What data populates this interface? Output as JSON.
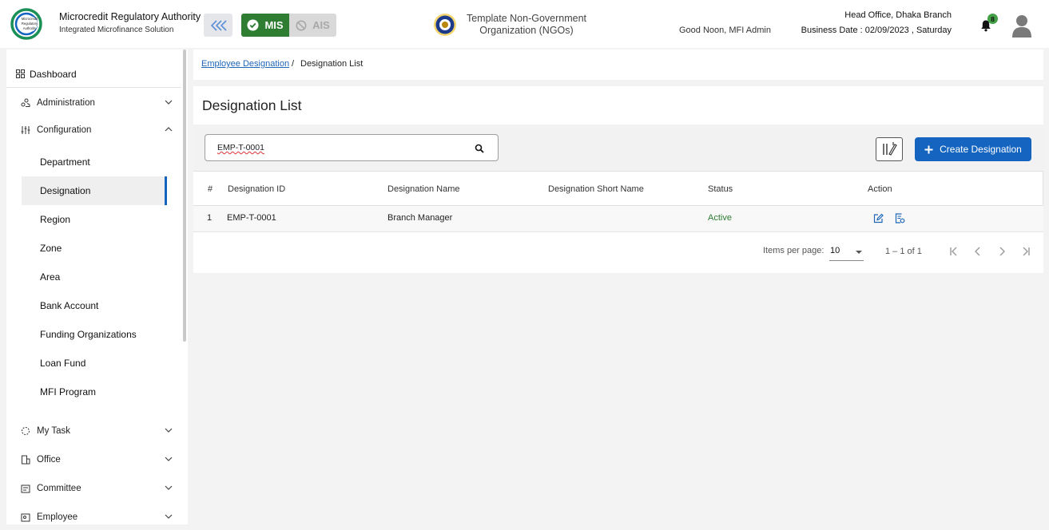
{
  "header": {
    "brand_title": "Microcredit Regulatory Authority",
    "brand_subtitle": "Integrated Microfinance Solution",
    "logo_text": [
      "Microcredit",
      "Regulatory",
      "Authority"
    ],
    "mis_label": "MIS",
    "ais_label": "AIS",
    "org_name_line1": "Template Non-Government",
    "org_name_line2": "Organization (NGOs)",
    "greeting": "Good Noon, MFI Admin",
    "branch": "Head Office, Dhaka Branch",
    "business_date": "Business Date : 02/09/2023 , Saturday",
    "notification_count": "8"
  },
  "sidebar": {
    "dashboard": "Dashboard",
    "administration": "Administration",
    "configuration": "Configuration",
    "config_items": [
      "Department",
      "Designation",
      "Region",
      "Zone",
      "Area",
      "Bank Account",
      "Funding Organizations",
      "Loan Fund",
      "MFI Program"
    ],
    "active_item": "Designation",
    "my_task": "My Task",
    "office": "Office",
    "committee": "Committee",
    "employee": "Employee"
  },
  "breadcrumb": {
    "parent": "Employee Designation",
    "separator": "/",
    "current": "Designation List"
  },
  "main": {
    "title": "Designation List",
    "search_value": "EMP-T-0001",
    "create_label": "Create Designation"
  },
  "table": {
    "headers": [
      "#",
      "Designation ID",
      "Designation Name",
      "Designation Short Name",
      "Status",
      "Action"
    ],
    "rows": [
      {
        "no": "1",
        "id": "EMP-T-0001",
        "name": "Branch Manager",
        "short_name": "",
        "status": "Active"
      }
    ]
  },
  "pagination": {
    "items_label": "Items per page:",
    "page_size": "10",
    "range": "1 – 1 of 1"
  },
  "colors": {
    "primary": "#1565c0",
    "mis_green": "#2e7d32",
    "status_active": "#2e7d32",
    "badge": "#43a047"
  }
}
